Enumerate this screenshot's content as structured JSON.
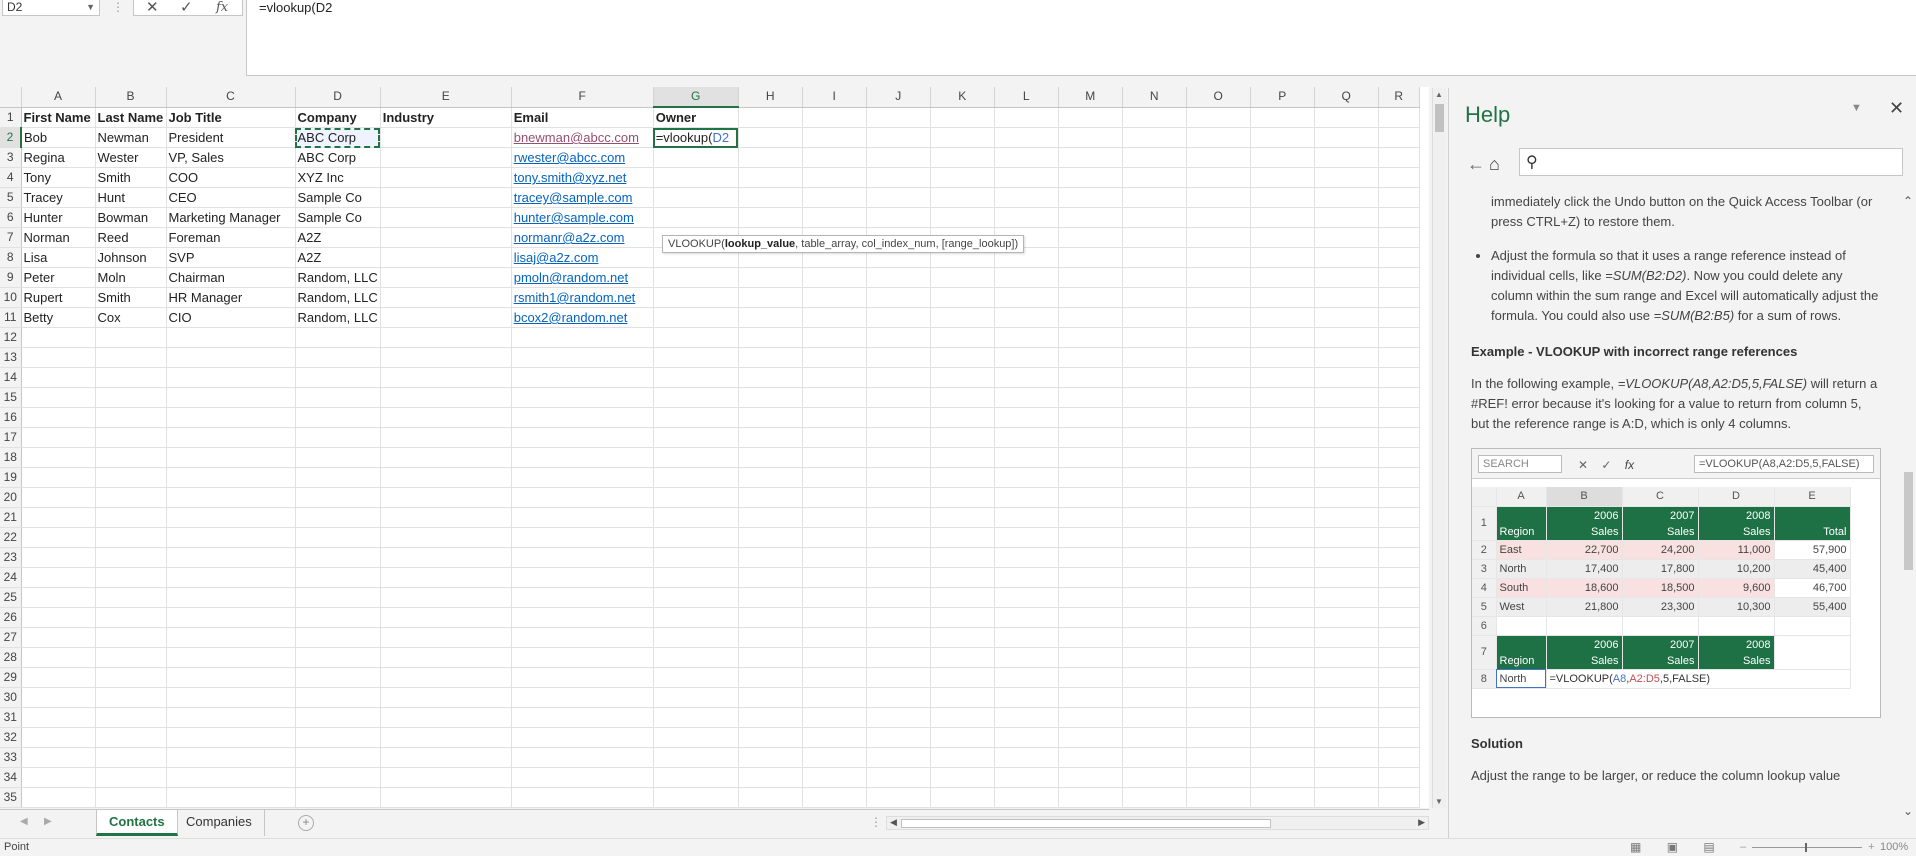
{
  "formula_bar": {
    "name_box": "D2",
    "formula": "=vlookup(D2",
    "cancel_icon": "✕",
    "enter_icon": "✓",
    "fx_icon": "fx"
  },
  "columns": [
    "A",
    "B",
    "C",
    "D",
    "E",
    "F",
    "G",
    "H",
    "I",
    "J",
    "K",
    "L",
    "M",
    "N",
    "O",
    "P",
    "Q",
    "R"
  ],
  "rows": [
    {
      "n": "1",
      "cells": [
        "First Name",
        "Last Name",
        "Job Title",
        "Company",
        "Industry",
        "Email",
        "Owner"
      ]
    },
    {
      "n": "2",
      "cells": [
        "Bob",
        "Newman",
        "President",
        "ABC Corp",
        "",
        "bnewman@abcc.com",
        "=vlookup(D2"
      ]
    },
    {
      "n": "3",
      "cells": [
        "Regina",
        "Wester",
        "VP, Sales",
        "ABC Corp",
        "",
        "rwester@abcc.com",
        ""
      ]
    },
    {
      "n": "4",
      "cells": [
        "Tony",
        "Smith",
        "COO",
        "XYZ Inc",
        "",
        "tony.smith@xyz.net",
        ""
      ]
    },
    {
      "n": "5",
      "cells": [
        "Tracey",
        "Hunt",
        "CEO",
        "Sample Co",
        "",
        "tracey@sample.com",
        ""
      ]
    },
    {
      "n": "6",
      "cells": [
        "Hunter",
        "Bowman",
        "Marketing Manager",
        "Sample Co",
        "",
        "hunter@sample.com",
        ""
      ]
    },
    {
      "n": "7",
      "cells": [
        "Norman",
        "Reed",
        "Foreman",
        "A2Z",
        "",
        "normanr@a2z.com",
        ""
      ]
    },
    {
      "n": "8",
      "cells": [
        "Lisa",
        "Johnson",
        "SVP",
        "A2Z",
        "",
        "lisaj@a2z.com",
        ""
      ]
    },
    {
      "n": "9",
      "cells": [
        "Peter",
        "Moln",
        "Chairman",
        "Random, LLC",
        "",
        "pmoln@random.net",
        ""
      ]
    },
    {
      "n": "10",
      "cells": [
        "Rupert",
        "Smith",
        "HR Manager",
        "Random, LLC",
        "",
        "rsmith1@random.net",
        ""
      ]
    },
    {
      "n": "11",
      "cells": [
        "Betty",
        "Cox",
        "CIO",
        "Random, LLC",
        "",
        "bcox2@random.net",
        ""
      ]
    }
  ],
  "empty_row_numbers": [
    "12",
    "13",
    "14",
    "15",
    "16",
    "17",
    "18",
    "19",
    "20",
    "21",
    "22",
    "23",
    "24",
    "25",
    "26",
    "27",
    "28",
    "29",
    "30",
    "31",
    "32",
    "33",
    "34",
    "35"
  ],
  "owner_cell": {
    "prefix": "=vlookup(",
    "ref": "D2"
  },
  "tooltip": {
    "fn": "VLOOKUP(",
    "arg1": "lookup_value",
    "rest": ", table_array, col_index_num, [range_lookup])"
  },
  "sheet_tabs": [
    {
      "label": "Contacts",
      "active": true
    },
    {
      "label": "Companies",
      "active": false
    }
  ],
  "status": {
    "mode": "Point",
    "zoom": "100%"
  },
  "colors": {
    "accent": "#217346",
    "link": "#0563c1",
    "visited": "#954f72",
    "example_green": "#1e7145"
  },
  "help": {
    "title": "Help",
    "search_placeholder": "",
    "para1": "immediately click the Undo button on the Quick Access Toolbar (or press CTRL+Z) to restore them.",
    "bullet_a": "Adjust the formula so that it uses a range reference instead of individual cells, like ",
    "bullet_b": "=SUM(B2:D2)",
    "bullet_c": ". Now you could delete any column within the sum range and Excel will automatically adjust the formula. You could also use ",
    "bullet_d": "=SUM(B2:B5)",
    "bullet_e": " for a sum of rows.",
    "example_heading": "Example - VLOOKUP with incorrect range references",
    "example_a": "In the following example, ",
    "example_b": "=VLOOKUP(A8,A2:D5,5,FALSE)",
    "example_c": " will return a #REF! error because it's looking for a value to return from column 5, but the reference range is A:D, which is only 4 columns.",
    "solution_heading": "Solution",
    "solution_text": "Adjust the range to be larger, or reduce the column lookup value",
    "example_image": {
      "name_box": "SEARCH",
      "formula": "=VLOOKUP(A8,A2:D5,5,FALSE)",
      "cols": [
        "A",
        "B",
        "C",
        "D",
        "E"
      ],
      "header": [
        "Region",
        "2006 Sales",
        "2007 Sales",
        "2008 Sales",
        "Total"
      ],
      "h1": [
        "2006",
        "2007",
        "2008"
      ],
      "h2": [
        "Sales",
        "Sales",
        "Sales"
      ],
      "data": [
        [
          "East",
          "22,700",
          "24,200",
          "11,000",
          "57,900"
        ],
        [
          "North",
          "17,400",
          "17,800",
          "10,200",
          "45,400"
        ],
        [
          "South",
          "18,600",
          "18,500",
          "9,600",
          "46,700"
        ],
        [
          "West",
          "21,800",
          "23,300",
          "10,300",
          "55,400"
        ]
      ],
      "row8_label": "North",
      "row8_formula_pre": "=VLOOKUP(",
      "row8_formula_a": "A8",
      "row8_formula_mid": ",",
      "row8_formula_b": "A2:D5",
      "row8_formula_post": ",5,FALSE)"
    }
  }
}
